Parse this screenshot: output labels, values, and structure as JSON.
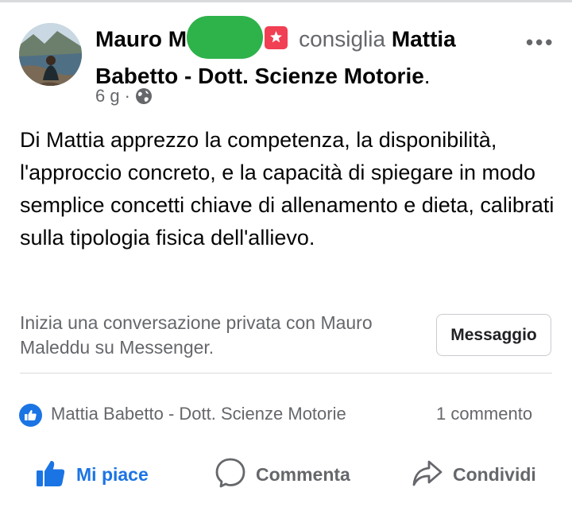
{
  "post": {
    "author": "Mauro M",
    "action": "consiglia",
    "page_name": "Mattia Babetto - Dott. Scienze Motorie",
    "period": ".",
    "time": "6 g",
    "separator": "·",
    "privacy_icon": "globe-icon",
    "more_icon": "•••",
    "body": "Di Mattia apprezzo la competenza, la disponibilità, l'approccio concreto, e la capacità di spiegare in modo semplice concetti chiave di allenamento e dieta, calibrati sulla tipologia fisica dell'allievo."
  },
  "messenger": {
    "prompt": "Inizia una conversazione privata con Mauro Maleddu su Messenger.",
    "button_label": "Messaggio"
  },
  "reactions": {
    "likers": "Mattia Babetto - Dott. Scienze Motorie",
    "comments_count": "1 commento"
  },
  "actions": {
    "like": "Mi piace",
    "comment": "Commenta",
    "share": "Condividi"
  },
  "colors": {
    "accent": "#1b74e4",
    "secondary_text": "#65676b",
    "recommend_badge": "#f13f53",
    "redaction": "#2eb24a"
  }
}
